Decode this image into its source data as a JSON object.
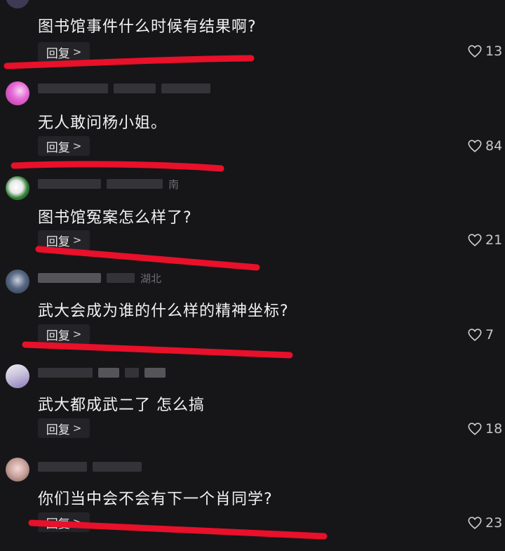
{
  "reply_label": "回复",
  "comments": [
    {
      "name": "",
      "text": "图书馆事件什么时候有结果啊?",
      "likes": "13"
    },
    {
      "name": "",
      "text": "无人敢问杨小姐。",
      "likes": "84"
    },
    {
      "name": "南",
      "text": "图书馆冤案怎么样了?",
      "likes": "21"
    },
    {
      "name": "湖北",
      "text": "武大会成为谁的什么样的精神坐标?",
      "likes": "7"
    },
    {
      "name": "",
      "text": "武大都成武二了 怎么搞",
      "likes": "18"
    },
    {
      "name": "",
      "text": "你们当中会不会有下一个肖同学?",
      "likes": "23"
    }
  ],
  "colors": {
    "underline": "#e8102a",
    "background": "#161618"
  }
}
